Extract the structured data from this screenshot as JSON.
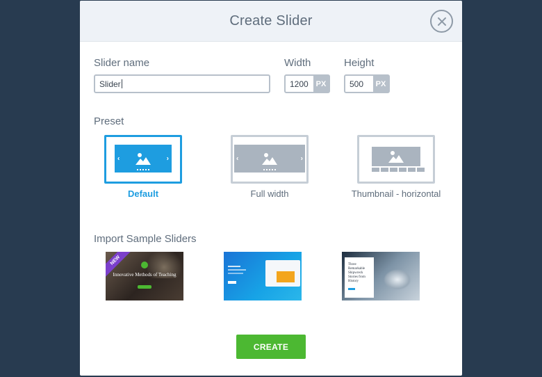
{
  "dialog": {
    "title": "Create Slider",
    "close_icon": "close-icon"
  },
  "form": {
    "slider_name_label": "Slider name",
    "slider_name_value": "Slider",
    "width_label": "Width",
    "width_value": "1200",
    "width_unit": "PX",
    "height_label": "Height",
    "height_value": "500",
    "height_unit": "PX"
  },
  "preset": {
    "section_label": "Preset",
    "options": [
      {
        "label": "Default",
        "selected": true
      },
      {
        "label": "Full width",
        "selected": false
      },
      {
        "label": "Thumbnail - horizontal",
        "selected": false
      }
    ]
  },
  "samples": {
    "section_label": "Import Sample Sliders",
    "items": [
      {
        "badge": "NEW",
        "title": "Innovative Methods of Teaching"
      },
      {
        "title": ""
      },
      {
        "title": "Three Remarkable Shipwreck Stories from History"
      }
    ]
  },
  "actions": {
    "create_label": "CREATE"
  },
  "colors": {
    "accent": "#1e9de0",
    "create": "#4cb832",
    "backdrop": "#283b50"
  }
}
